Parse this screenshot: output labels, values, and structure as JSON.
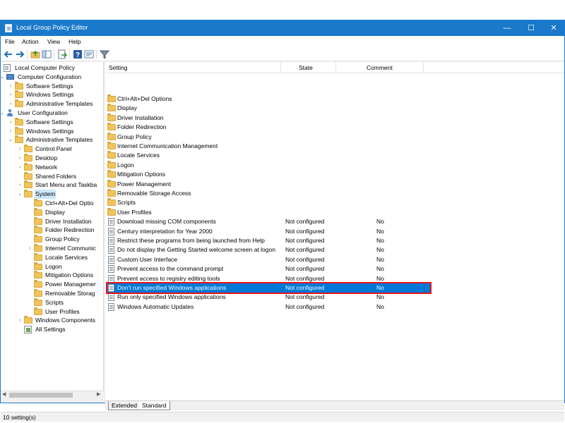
{
  "window": {
    "title": "Local Group Policy Editor",
    "controls": {
      "minimize": "—",
      "maximize": "☐",
      "close": "✕"
    }
  },
  "menu": [
    "File",
    "Action",
    "View",
    "Help"
  ],
  "toolbar": {
    "icons": [
      "back-icon",
      "forward-icon",
      "up-folder-icon",
      "show-hide-tree-icon",
      "export-list-icon",
      "help-icon",
      "properties-icon",
      "filter-icon"
    ]
  },
  "tree": [
    {
      "label": "Local Computer Policy",
      "icon": "doc",
      "arrow": "",
      "level": 0
    },
    {
      "label": "Computer Configuration",
      "icon": "pc",
      "arrow": "v",
      "level": 1
    },
    {
      "label": "Software Settings",
      "icon": "folder",
      "arrow": ">",
      "level": 2
    },
    {
      "label": "Windows Settings",
      "icon": "folder",
      "arrow": ">",
      "level": 2
    },
    {
      "label": "Administrative Templates",
      "icon": "folder",
      "arrow": ">",
      "level": 2
    },
    {
      "label": "User Configuration",
      "icon": "user",
      "arrow": "v",
      "level": 1
    },
    {
      "label": "Software Settings",
      "icon": "folder",
      "arrow": ">",
      "level": 2
    },
    {
      "label": "Windows Settings",
      "icon": "folder",
      "arrow": ">",
      "level": 2
    },
    {
      "label": "Administrative Templates",
      "icon": "folder",
      "arrow": "v",
      "level": 2
    },
    {
      "label": "Control Panel",
      "icon": "folder",
      "arrow": ">",
      "level": 3
    },
    {
      "label": "Desktop",
      "icon": "folder",
      "arrow": ">",
      "level": 3
    },
    {
      "label": "Network",
      "icon": "folder",
      "arrow": ">",
      "level": 3
    },
    {
      "label": "Shared Folders",
      "icon": "folder",
      "arrow": "",
      "level": 3
    },
    {
      "label": "Start Menu and Taskba",
      "icon": "folder",
      "arrow": ">",
      "level": 3
    },
    {
      "label": "System",
      "icon": "folder",
      "arrow": "v",
      "level": 3,
      "selected": true
    },
    {
      "label": "Ctrl+Alt+Del Optio",
      "icon": "folder",
      "arrow": "",
      "level": 4
    },
    {
      "label": "Display",
      "icon": "folder",
      "arrow": "",
      "level": 4
    },
    {
      "label": "Driver Installation",
      "icon": "folder",
      "arrow": "",
      "level": 4
    },
    {
      "label": "Folder Redirection",
      "icon": "folder",
      "arrow": "",
      "level": 4
    },
    {
      "label": "Group Policy",
      "icon": "folder",
      "arrow": "",
      "level": 4
    },
    {
      "label": "Internet Communic",
      "icon": "folder",
      "arrow": ">",
      "level": 4
    },
    {
      "label": "Locale Services",
      "icon": "folder",
      "arrow": "",
      "level": 4
    },
    {
      "label": "Logon",
      "icon": "folder",
      "arrow": "",
      "level": 4
    },
    {
      "label": "Mitigation Options",
      "icon": "folder",
      "arrow": "",
      "level": 4
    },
    {
      "label": "Power Managemer",
      "icon": "folder",
      "arrow": "",
      "level": 4
    },
    {
      "label": "Removable Storag",
      "icon": "folder",
      "arrow": "",
      "level": 4
    },
    {
      "label": "Scripts",
      "icon": "folder",
      "arrow": "",
      "level": 4
    },
    {
      "label": "User Profiles",
      "icon": "folder",
      "arrow": "",
      "level": 4
    },
    {
      "label": "Windows Components",
      "icon": "folder",
      "arrow": ">",
      "level": 3
    },
    {
      "label": "All Settings",
      "icon": "allsettings",
      "arrow": "",
      "level": 3
    }
  ],
  "list": {
    "headers": {
      "setting": "Setting",
      "state": "State",
      "comment": "Comment"
    },
    "folders": [
      "Ctrl+Alt+Del Options",
      "Display",
      "Driver Installation",
      "Folder Redirection",
      "Group Policy",
      "Internet Communication Management",
      "Locale Services",
      "Logon",
      "Mitigation Options",
      "Power Management",
      "Removable Storage Access",
      "Scripts",
      "User Profiles"
    ],
    "settings": [
      {
        "name": "Download missing COM components",
        "state": "Not configured",
        "comment": "No"
      },
      {
        "name": "Century interpretation for Year 2000",
        "state": "Not configured",
        "comment": "No"
      },
      {
        "name": "Restrict these programs from being launched from Help",
        "state": "Not configured",
        "comment": "No"
      },
      {
        "name": "Do not display the Getting Started welcome screen at logon",
        "state": "Not configured",
        "comment": "No"
      },
      {
        "name": "Custom User Interface",
        "state": "Not configured",
        "comment": "No"
      },
      {
        "name": "Prevent access to the command prompt",
        "state": "Not configured",
        "comment": "No"
      },
      {
        "name": "Prevent access to registry editing tools",
        "state": "Not configured",
        "comment": "No"
      },
      {
        "name": "Don't run specified Windows applications",
        "state": "Not configured",
        "comment": "No",
        "selected": true
      },
      {
        "name": "Run only specified Windows applications",
        "state": "Not configured",
        "comment": "No"
      },
      {
        "name": "Windows Automatic Updates",
        "state": "Not configured",
        "comment": "No"
      }
    ]
  },
  "tabs": {
    "extended": "Extended",
    "standard": "Standard"
  },
  "status": "10 setting(s)",
  "colors": {
    "titlebar": "#1979ca",
    "selection": "#0078d7",
    "highlight_border": "#e8141b",
    "folder": "#f0c45c"
  }
}
